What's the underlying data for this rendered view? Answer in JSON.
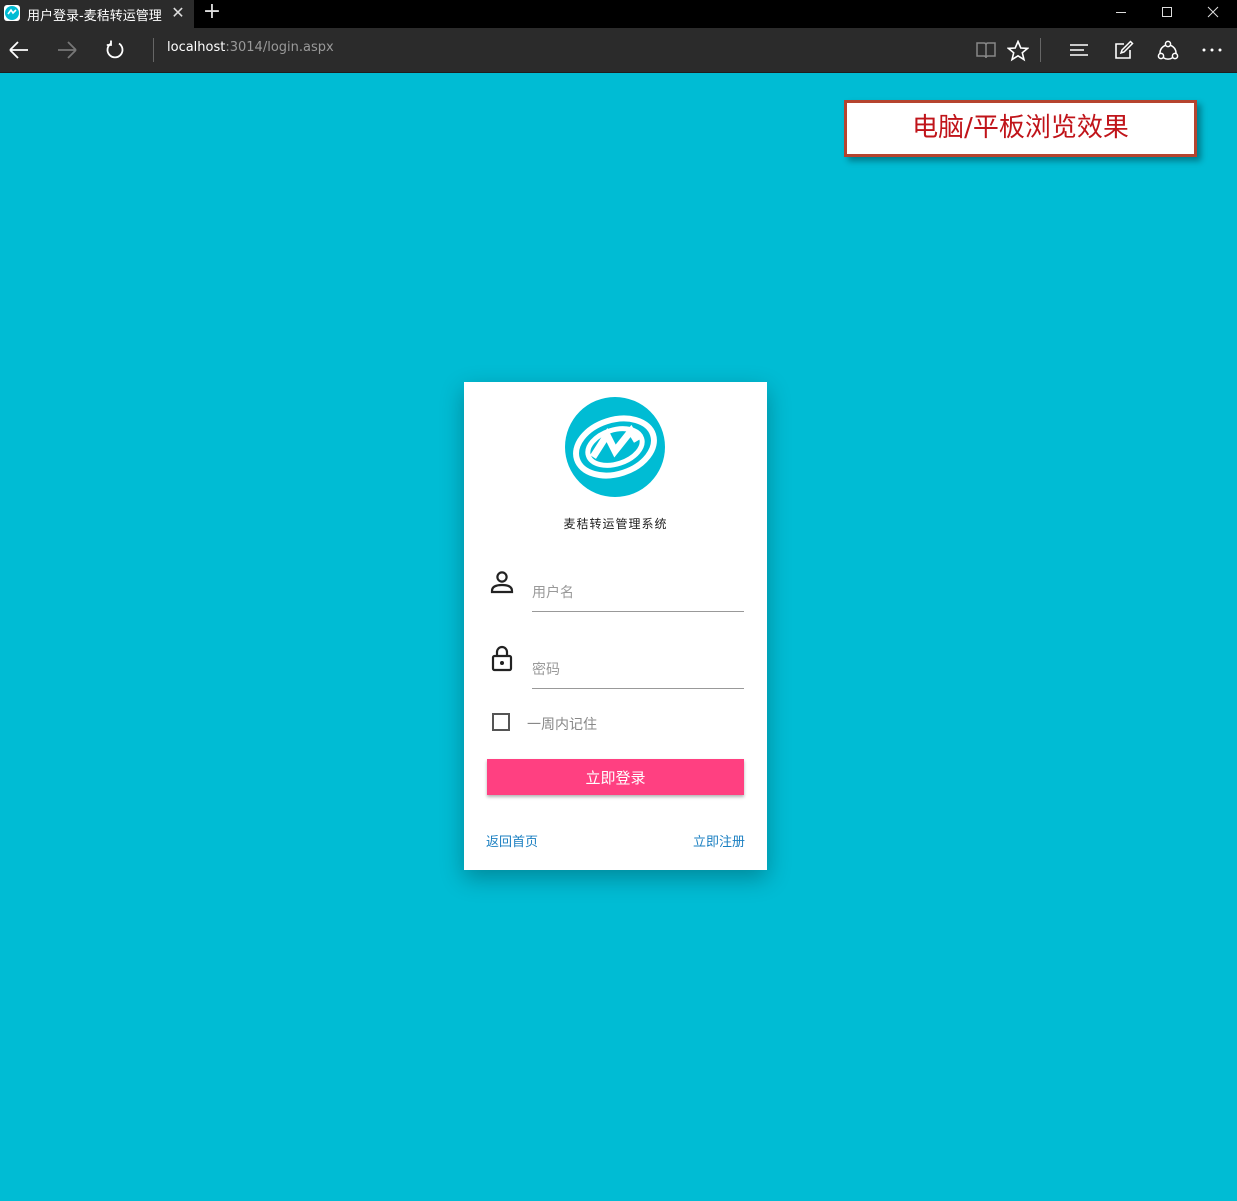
{
  "browser": {
    "tab_title": "用户登录-麦秸转运管理",
    "tab_close": "✕",
    "new_tab": "+",
    "address_host": "localhost",
    "address_path": ":3014/login.aspx",
    "icons": [
      "back-icon",
      "forward-icon",
      "refresh-icon",
      "reading-view-icon",
      "favorite-star-icon",
      "hub-icon",
      "web-note-icon",
      "share-icon",
      "more-icon"
    ]
  },
  "overlay_label": "电脑/平板浏览效果",
  "login": {
    "app_name": "麦秸转运管理系统",
    "username_placeholder": "用户名",
    "password_placeholder": "密码",
    "remember_label": "一周内记住",
    "submit_label": "立即登录",
    "home_link": "返回首页",
    "register_link": "立即注册"
  },
  "colors": {
    "background": "#00bcd4",
    "button": "#ff4081",
    "link": "#1a7fc1",
    "overlay_border": "#b5442f",
    "overlay_text": "#c0141a"
  }
}
